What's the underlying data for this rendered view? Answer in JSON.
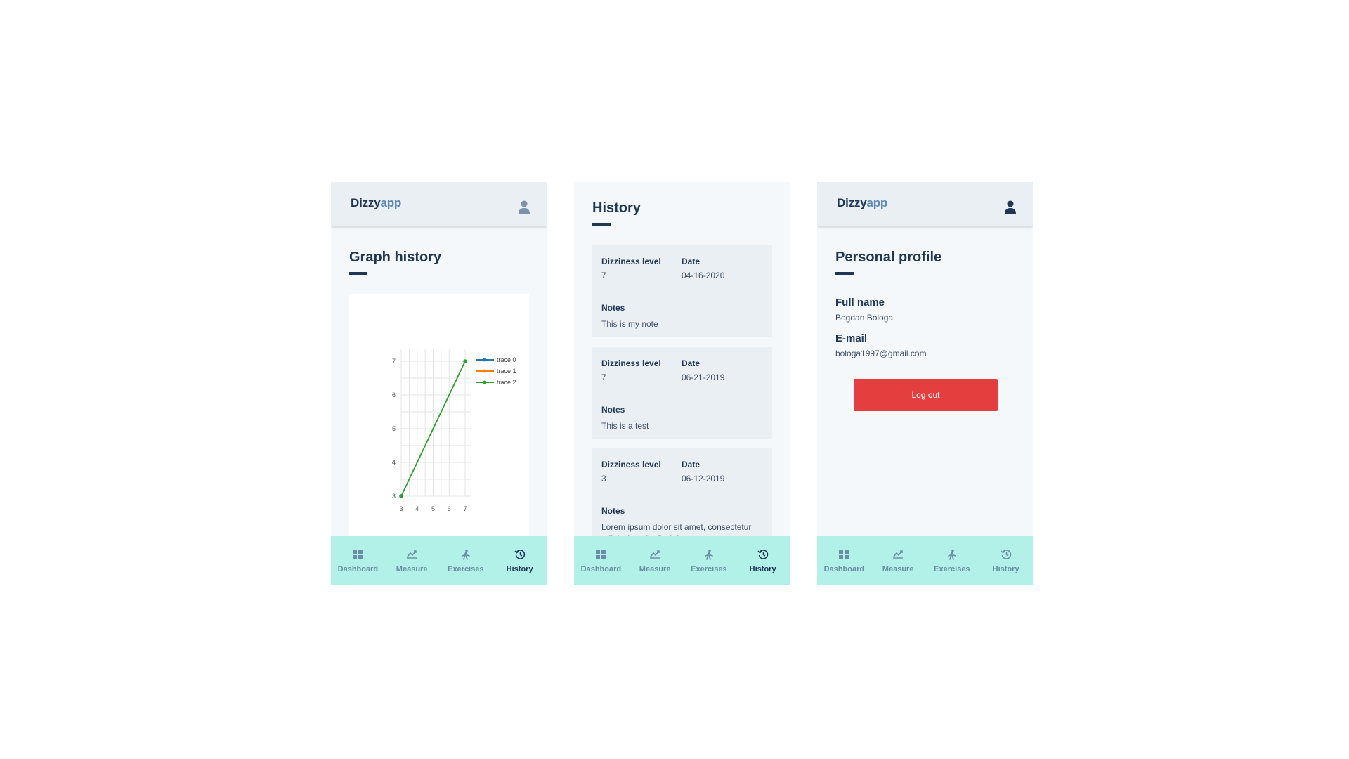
{
  "app": {
    "logo_main": "Dizzy",
    "logo_accent": "app"
  },
  "nav": {
    "items": [
      {
        "label": "Dashboard",
        "icon": "dashboard-icon"
      },
      {
        "label": "Measure",
        "icon": "measure-icon"
      },
      {
        "label": "Exercises",
        "icon": "exercises-icon"
      },
      {
        "label": "History",
        "icon": "history-icon"
      }
    ]
  },
  "screens": {
    "graph": {
      "title": "Graph history",
      "active_nav": "History"
    },
    "history": {
      "title": "History",
      "active_nav": "History",
      "labels": {
        "level": "Dizziness level",
        "date": "Date",
        "notes": "Notes"
      },
      "entries": [
        {
          "level": "7",
          "date": "04-16-2020",
          "notes": "This is my note"
        },
        {
          "level": "7",
          "date": "06-21-2019",
          "notes": "This is a test"
        },
        {
          "level": "3",
          "date": "06-12-2019",
          "notes": "Lorem ipsum dolor sit amet, consectetur adipiscing elit. Sed do"
        }
      ]
    },
    "profile": {
      "title": "Personal profile",
      "active_nav": "",
      "full_name_label": "Full name",
      "full_name": "Bogdan Bologa",
      "email_label": "E-mail",
      "email": "bologa1997@gmail.com",
      "logout_label": "Log out"
    }
  },
  "chart_data": {
    "type": "line",
    "title": "",
    "xlabel": "",
    "ylabel": "",
    "xlim": [
      3,
      7
    ],
    "ylim": [
      3,
      7
    ],
    "xticks": [
      3,
      4,
      5,
      6,
      7
    ],
    "yticks": [
      3,
      4,
      5,
      6,
      7
    ],
    "grid": true,
    "legend_position": "top-right",
    "series": [
      {
        "name": "trace 0",
        "color": "#1f77b4",
        "x": [],
        "y": []
      },
      {
        "name": "trace 1",
        "color": "#ff7f0e",
        "x": [],
        "y": []
      },
      {
        "name": "trace 2",
        "color": "#2ca02c",
        "x": [
          3,
          7
        ],
        "y": [
          3,
          7
        ]
      }
    ]
  },
  "colors": {
    "primary": "#1f3655",
    "nav_bg": "#b2f1e8",
    "danger": "#e53e3e",
    "card_bg": "#eaeff3"
  }
}
